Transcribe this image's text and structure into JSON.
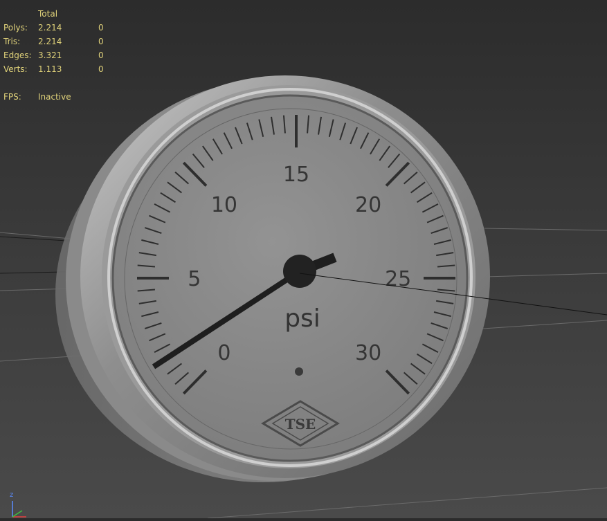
{
  "stats": {
    "header": "Total",
    "rows": [
      {
        "label": "Polys:",
        "total": "2.214",
        "selected": "0"
      },
      {
        "label": "Tris:",
        "total": "2.214",
        "selected": "0"
      },
      {
        "label": "Edges:",
        "total": "3.321",
        "selected": "0"
      },
      {
        "label": "Verts:",
        "total": "1.113",
        "selected": "0"
      }
    ],
    "fps_label": "FPS:",
    "fps_value": "Inactive"
  },
  "gauge": {
    "labels": [
      "0",
      "5",
      "10",
      "15",
      "20",
      "25",
      "30"
    ],
    "unit": "psi",
    "brand": "TSE",
    "needle_value_psi": 0
  },
  "axis": {
    "z_label": "z"
  },
  "colors": {
    "stats_text": "#e0d27a",
    "viewport_bg": "#3a3a3a",
    "dial_face": "#8c8c8c",
    "ink": "#2e2e2e"
  }
}
